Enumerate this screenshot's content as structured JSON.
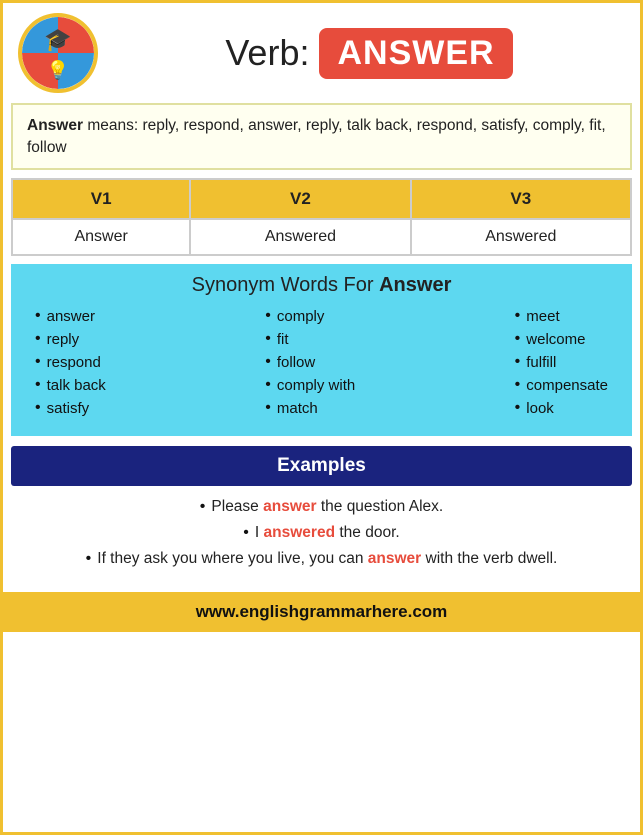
{
  "header": {
    "logo_alt": "English Grammar Here",
    "title": "Verb:",
    "verb_badge": "ANSWER"
  },
  "means": {
    "word": "Answer",
    "definition": "means: reply, respond, answer, reply, talk back, respond, satisfy, comply, fit, follow"
  },
  "verb_forms": {
    "headers": [
      "V1",
      "V2",
      "V3"
    ],
    "row": [
      "Answer",
      "Answered",
      "Answered"
    ]
  },
  "synonym": {
    "title_pre": "Synonym Words For ",
    "title_bold": "Answer",
    "columns": [
      [
        "answer",
        "reply",
        "respond",
        "talk back",
        "satisfy"
      ],
      [
        "comply",
        "fit",
        "follow",
        "comply with",
        "match"
      ],
      [
        "meet",
        "welcome",
        "fulfill",
        "compensate",
        "look"
      ]
    ]
  },
  "examples": {
    "header": "Examples",
    "items": [
      {
        "text_before": "Please ",
        "highlight": "answer",
        "text_after": " the question Alex."
      },
      {
        "text_before": "I ",
        "highlight": "answered",
        "text_after": " the door."
      },
      {
        "text_before": "If they ask you where you live, you can ",
        "highlight": "answer",
        "text_after": " with the verb dwell."
      }
    ]
  },
  "footer": {
    "url": "www.englishgrammarhere.com"
  }
}
